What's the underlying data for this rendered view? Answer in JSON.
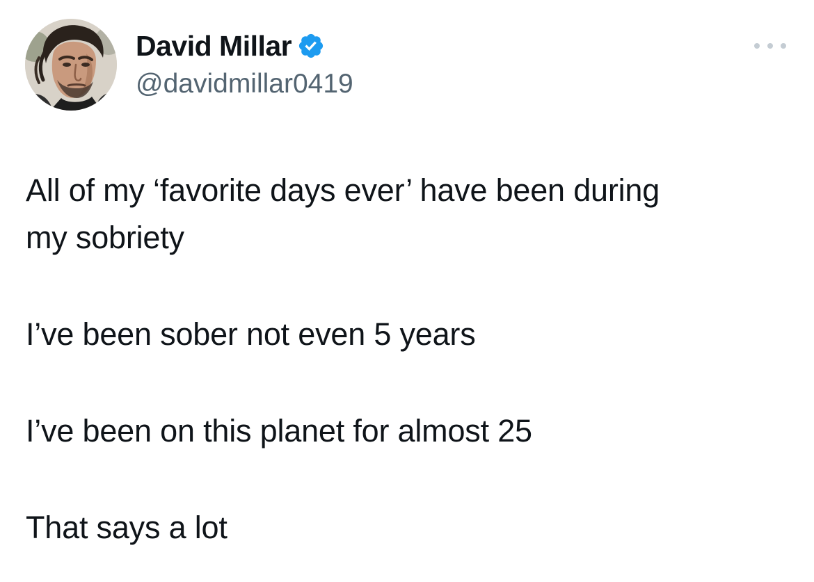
{
  "author": {
    "display_name": "David Millar",
    "handle": "@davidmillar0419",
    "verified_icon": "verified-badge-icon",
    "avatar_alt": "profile-photo"
  },
  "menu": {
    "icon": "more-horizontal-icon"
  },
  "tweet": {
    "paragraphs": [
      "All of my ‘favorite days ever’ have been during\nmy sobriety",
      "I’ve been sober not even 5 years",
      "I’ve been on this planet for almost 25",
      "That says a lot"
    ]
  },
  "colors": {
    "text_primary": "#0f1419",
    "text_secondary": "#536471",
    "verified_blue": "#1d9bf0",
    "menu_dots": "#c4ccd3",
    "background": "#ffffff"
  }
}
